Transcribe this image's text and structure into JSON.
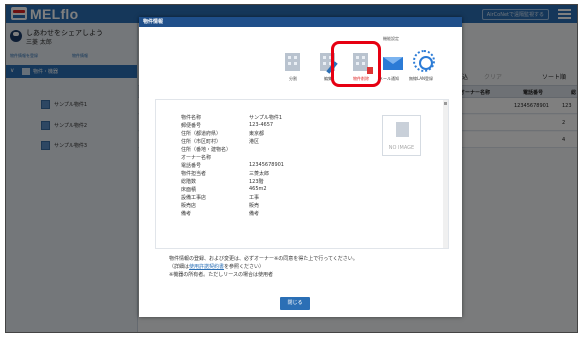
{
  "app": {
    "brand": "MELflo",
    "aircontrol_button": "AirCoNetで遠隔監視する"
  },
  "sidebar": {
    "user_line1": "しあわせをシェアしよう",
    "user_line2": "三菱 太郎",
    "link_left": "物件情報を登録",
    "link_right": "物件情報",
    "folder_label": "物件・機器",
    "items": [
      "サンプル物件1",
      "サンプル物件2",
      "サンプル物件3"
    ]
  },
  "background": {
    "toolbar": [
      "絞込",
      "クリア",
      "ソート順"
    ],
    "columns": [
      "オーナー名称",
      "電話番号",
      "総"
    ],
    "rows": [
      {
        "phone": "12345678901",
        "extra": "123"
      },
      {
        "phone": "",
        "extra": "2"
      },
      {
        "phone": "",
        "extra": "4"
      }
    ]
  },
  "modal": {
    "title": "物件情報",
    "function_setting": "機能設定",
    "tool_buttons": [
      "分割",
      "編集",
      "物件削除"
    ],
    "function_buttons": [
      "メール通知",
      "無線LAN登録"
    ],
    "fields": [
      {
        "label": "物件名称",
        "value": "サンプル物件1"
      },
      {
        "label": "郵便番号",
        "value": "123-4657"
      },
      {
        "label": "住所（都道府県）",
        "value": "東京都"
      },
      {
        "label": "住所（市区町村）",
        "value": "港区"
      },
      {
        "label": "住所（番地・建物名）",
        "value": ""
      },
      {
        "label": "オーナー名称",
        "value": ""
      },
      {
        "label": "電話番号",
        "value": "12345678901"
      },
      {
        "label": "物件担当者",
        "value": "三菱太郎"
      },
      {
        "label": "総階数",
        "value": "123階"
      },
      {
        "label": "床面積",
        "value": "465m2"
      },
      {
        "label": "設備工事店",
        "value": "工事"
      },
      {
        "label": "販売店",
        "value": "販売"
      },
      {
        "label": "備考",
        "value": "備考"
      }
    ],
    "no_image": "NO IMAGE",
    "note1": "物件情報の登録、および変更は、必ずオーナー※の同意を得た上で行ってください。",
    "note2_prefix": "（詳細は",
    "note2_link": "使用許諾契約書",
    "note2_suffix": "を参照ください）",
    "note3": "※機器の所有者。ただしリースの場合は使用者",
    "close_button": "閉じる"
  }
}
